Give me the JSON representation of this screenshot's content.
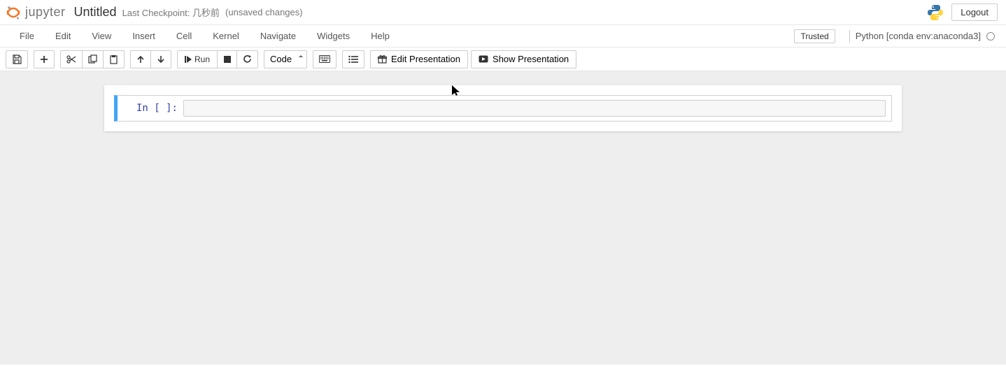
{
  "header": {
    "logo_text": "jupyter",
    "title": "Untitled",
    "checkpoint_prefix": "Last Checkpoint: ",
    "checkpoint_time": "几秒前",
    "unsaved": "(unsaved changes)",
    "logout": "Logout"
  },
  "menubar": {
    "items": [
      "File",
      "Edit",
      "View",
      "Insert",
      "Cell",
      "Kernel",
      "Navigate",
      "Widgets",
      "Help"
    ],
    "trusted": "Trusted",
    "kernel": "Python [conda env:anaconda3]"
  },
  "toolbar": {
    "run_label": "Run",
    "celltype": "Code",
    "edit_presentation": "Edit Presentation",
    "show_presentation": "Show Presentation"
  },
  "cell": {
    "prompt": "In [ ]:",
    "content": ""
  }
}
